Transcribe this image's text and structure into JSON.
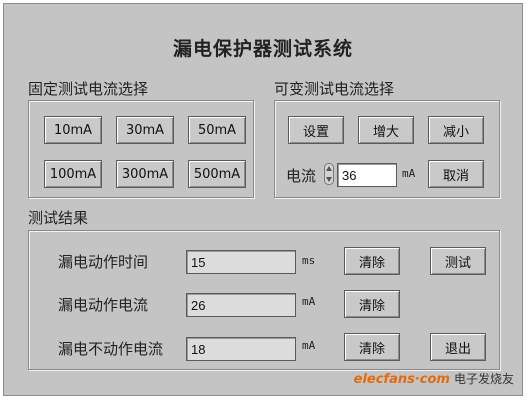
{
  "title": "漏电保护器测试系统",
  "fixed_group": {
    "label": "固定测试电流选择",
    "buttons": [
      "10mA",
      "30mA",
      "50mA",
      "100mA",
      "300mA",
      "500mA"
    ]
  },
  "variable_group": {
    "label": "可变测试电流选择",
    "set_label": "设置",
    "increase_label": "增大",
    "decrease_label": "减小",
    "current_label": "电流",
    "current_value": "36",
    "unit": "mA",
    "cancel_label": "取消"
  },
  "results": {
    "label": "测试结果",
    "rows": [
      {
        "label": "漏电动作时间",
        "value": "15",
        "unit": "ms",
        "clear_label": "清除"
      },
      {
        "label": "漏电动作电流",
        "value": "26",
        "unit": "mA",
        "clear_label": "清除"
      },
      {
        "label": "漏电不动作电流",
        "value": "18",
        "unit": "mA",
        "clear_label": "清除"
      }
    ],
    "test_label": "测试",
    "exit_label": "退出"
  },
  "watermark": {
    "text": "elecfans·com",
    "cn": "电子发烧友"
  }
}
